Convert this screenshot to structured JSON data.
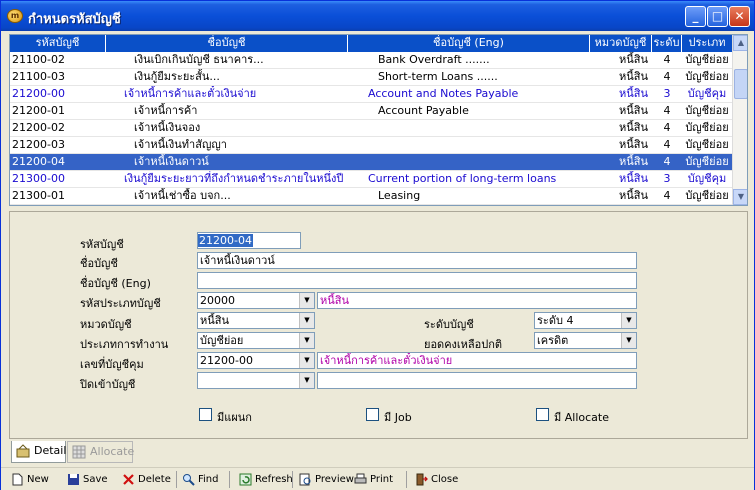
{
  "window": {
    "title": "กำหนดรหัสบัญชี"
  },
  "grid": {
    "headers": [
      "รหัสบัญชี",
      "ชื่อบัญชี",
      "ชื่อบัญชี (Eng)",
      "หมวดบัญชี",
      "ระดับ",
      "ประเภท"
    ],
    "rows": [
      {
        "code": "21100-02",
        "name": "เงินเบิกเกินบัญชี ธนาคาร...",
        "eng": "Bank Overdraft .......",
        "cat": "หนี้สิน",
        "level": "4",
        "type": "บัญชีย่อย"
      },
      {
        "code": "21100-03",
        "name": "เงินกู้ยืมระยะสั้น...",
        "eng": "Short-term Loans ......",
        "cat": "หนี้สิน",
        "level": "4",
        "type": "บัญชีย่อย"
      },
      {
        "code": "21200-00",
        "name": "เจ้าหนี้การค้าและตั๋วเงินจ่าย",
        "eng": "Account and Notes Payable",
        "cat": "หนี้สิน",
        "level": "3",
        "type": "บัญชีคุม"
      },
      {
        "code": "21200-01",
        "name": "เจ้าหนี้การค้า",
        "eng": "Account Payable",
        "cat": "หนี้สิน",
        "level": "4",
        "type": "บัญชีย่อย"
      },
      {
        "code": "21200-02",
        "name": "เจ้าหนี้เงินจอง",
        "eng": "",
        "cat": "หนี้สิน",
        "level": "4",
        "type": "บัญชีย่อย"
      },
      {
        "code": "21200-03",
        "name": "เจ้าหนี้เงินทำสัญญา",
        "eng": "",
        "cat": "หนี้สิน",
        "level": "4",
        "type": "บัญชีย่อย"
      },
      {
        "code": "21200-04",
        "name": "เจ้าหนี้เงินดาวน์",
        "eng": "",
        "cat": "หนี้สิน",
        "level": "4",
        "type": "บัญชีย่อย"
      },
      {
        "code": "21300-00",
        "name": "เงินกู้ยืมระยะยาวที่ถึงกำหนดชำระภายในหนึ่งปี",
        "eng": "Current portion of long-term loans",
        "cat": "หนี้สิน",
        "level": "3",
        "type": "บัญชีคุม"
      },
      {
        "code": "21300-01",
        "name": "เจ้าหนี้เช่าซื้อ บจก...",
        "eng": "Leasing",
        "cat": "หนี้สิน",
        "level": "4",
        "type": "บัญชีย่อย"
      }
    ]
  },
  "form": {
    "code_label": "รหัสบัญชี",
    "code_value": "21200-04",
    "name_label": "ชื่อบัญชี",
    "name_value": "เจ้าหนี้เงินดาวน์",
    "eng_label": "ชื่อบัญชี (Eng)",
    "eng_value": "",
    "acctype_label": "รหัสประเภทบัญชี",
    "acctype_value": "20000",
    "acctype_desc": "หนี้สิน",
    "cat_label": "หมวดบัญชี",
    "cat_value": "หนี้สิน",
    "level_label": "ระดับบัญชี",
    "level_value": "ระดับ 4",
    "worktype_label": "ประเภทการทำงาน",
    "worktype_value": "บัญชีย่อย",
    "balance_label": "ยอดคงเหลือปกติ",
    "balance_value": "เครดิต",
    "control_label": "เลขที่บัญชีคุม",
    "control_value": "21200-00",
    "control_desc": "เจ้าหนี้การค้าและตั๋วเงินจ่าย",
    "close_label": "ปิดเข้าบัญชี",
    "close_value": "",
    "close_desc": "",
    "chk_plan": "มีแผนก",
    "chk_job": "มี Job",
    "chk_alloc": "มี Allocate"
  },
  "tabs": {
    "detail": "Detail",
    "allocate": "Allocate"
  },
  "toolbar": {
    "new": "New",
    "save": "Save",
    "delete": "Delete",
    "find": "Find",
    "refresh": "Refresh",
    "preview": "Preview",
    "print": "Print",
    "close": "Close"
  }
}
